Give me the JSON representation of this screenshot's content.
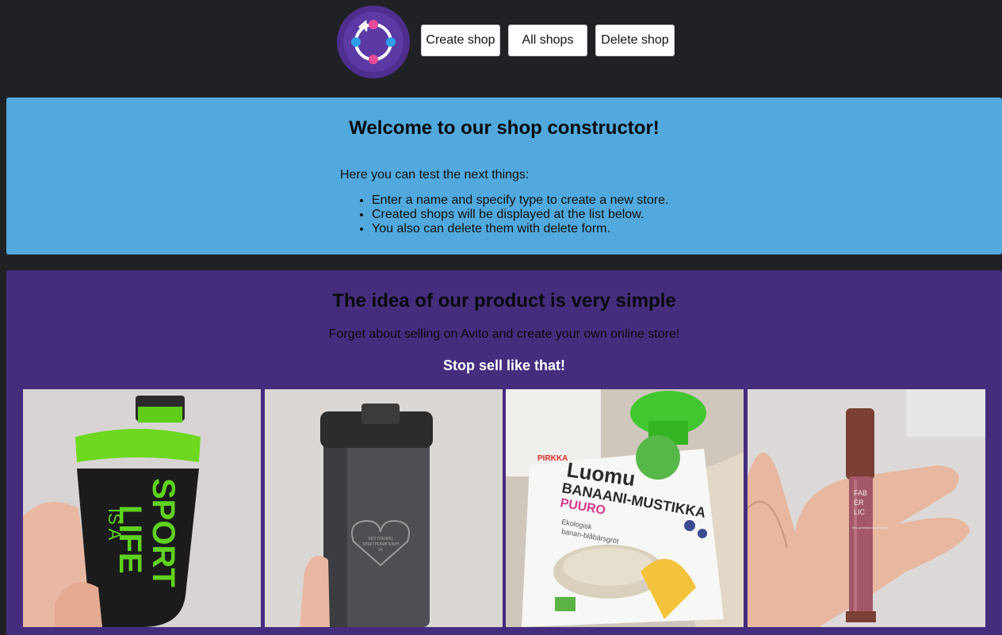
{
  "header": {
    "logo_icon": "shop-cycle-logo-icon",
    "nav": [
      {
        "label": "Create shop"
      },
      {
        "label": "All shops"
      },
      {
        "label": "Delete shop"
      }
    ]
  },
  "welcome": {
    "title": "Welcome to our shop constructor!",
    "intro": "Here you can test the next things:",
    "items": [
      "Enter a name and specify type to create a new store.",
      "Created shops will be displayed at the list below.",
      "You also can delete them with delete form."
    ],
    "background": "#51a9de"
  },
  "idea": {
    "title": "The idea of our product is very simple",
    "tagline": "Forget about selling on Avito and create your own online store!",
    "stop_text": "Stop sell like that!",
    "background": "#452d7e",
    "photos": [
      {
        "subject": "shaker-bottle-photo",
        "lines": [
          "IS A",
          "LIFE",
          "SPORT"
        ]
      },
      {
        "subject": "travel-mug-photo",
        "lines": [
          "БЕЗ ГРАНИЦ",
          "ЭЛЕКТРОМАГАЗИН",
          "24"
        ]
      },
      {
        "subject": "baby-food-pouch-photo",
        "lines": [
          "PIRKKA",
          "Luomu",
          "BANAANI-MUSTIKKA",
          "PUURO",
          "Ekologisk",
          "banan-blåbärsgröt"
        ]
      },
      {
        "subject": "lip-gloss-photo",
        "lines": [
          "FAB",
          "ER",
          "LIC",
          "New generation liquid lipstick"
        ]
      }
    ]
  },
  "colors": {
    "page_bg": "#202124",
    "button_bg": "#ffffff"
  }
}
